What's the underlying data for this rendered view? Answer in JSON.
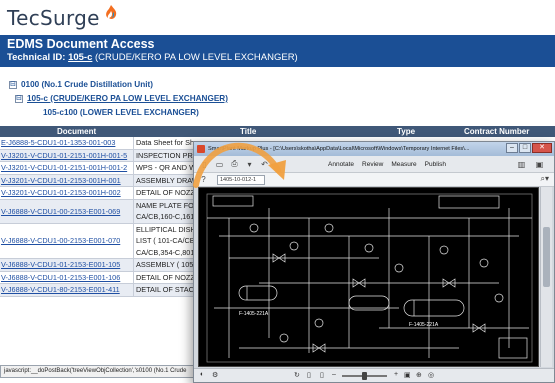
{
  "logo": {
    "text": "TecSurge"
  },
  "banner": {
    "title": "EDMS Document Access",
    "technical_id_label": "Technical ID:",
    "technical_id": "105-c",
    "technical_id_desc": "(CRUDE/KERO PA LOW LEVEL EXCHANGER)"
  },
  "tree": {
    "items": [
      {
        "toggle": "⊟",
        "label": "0100 (No.1 Crude Distillation Unit)"
      },
      {
        "toggle": "⊟",
        "label": "105-c (CRUDE/KERO PA LOW LEVEL EXCHANGER)"
      },
      {
        "label": "105-c100 (LOWER LEVEL EXCHANGER)"
      }
    ]
  },
  "table": {
    "headers": [
      "Document",
      "Title",
      "Type",
      "Contract Number"
    ],
    "rows": [
      {
        "doc": "E-J6888-5-CDU1-01-1353-001-003",
        "title": "Data Sheet for She"
      },
      {
        "doc": "V-J3201-V-CDU1-01-2151-001H-001-5",
        "title": "INSPECTION PROC"
      },
      {
        "doc": "V-J3201-V-CDU1-01-2151-001H-001-2",
        "title": "WPS - QR AND W"
      },
      {
        "doc": "V-J3201-V-CDU1-01-2153-001H-001",
        "title": "ASSEMBLY DRAWI"
      },
      {
        "doc": "V-J3201-V-CDU1-01-2153-001H-002",
        "title": "DETAIL OF NOZZL"
      },
      {
        "doc": "V-J6888-V-CDU1-00-2153-E001-069",
        "title": "NAME PLATE FOR",
        "title2": "CA/CB,160-C,161-"
      },
      {
        "doc": "V-J6888-V-CDU1-00-2153-E001-070",
        "title": "ELLIPTICAL DISHE",
        "title2": "LIST ( 101-CA/CB,",
        "title3": "CA/CB,354-C,801-"
      },
      {
        "doc": "V-J6888-V-CDU1-01-2153-E001-105",
        "title": "ASSEMBLY ( 105-C"
      },
      {
        "doc": "V-J6888-V-CDU1-01-2153-E001-106",
        "title": "DETAIL OF NOZZL"
      },
      {
        "doc": "V-J6888-V-CDU1-80-2153-E001-411",
        "title": "DETAIL OF STACK"
      }
    ]
  },
  "status_bar": {
    "text": "javascript:__doPostBack('treeViewObjCollection','s0100 (No.1 Crude"
  },
  "viewer": {
    "title": "SmartPlant Markup Plus - [C:\\Users\\skotha\\AppData\\Local\\Microsoft\\Windows\\Temporary Internet Files\\...",
    "menu": [
      "Annotate",
      "Review",
      "Measure",
      "Publish"
    ],
    "address": "1405-10-012-1",
    "labels": [
      "F-1405-221A",
      "F-1405-221A"
    ]
  },
  "colors": {
    "banner": "#1b4f95",
    "header": "#405878",
    "arrow": "#f0a040",
    "accent": "#f36f21"
  }
}
